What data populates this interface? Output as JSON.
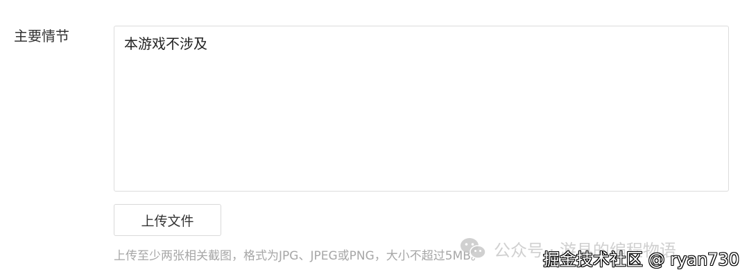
{
  "form": {
    "plot_label": "主要情节",
    "plot_value": "本游戏不涉及",
    "upload_button_label": "上传文件",
    "upload_hint": "上传至少两张相关截图，格式为JPG、JPEG或PNG，大小不超过5MB。"
  },
  "watermarks": {
    "wechat_account": "公众号 · 游县的编程物语",
    "juejin_credit": "掘金技术社区 @ ryan730"
  },
  "icons": {
    "wechat": "wechat-icon"
  },
  "colors": {
    "border": "#dcdcdc",
    "label_text": "#333333",
    "hint_text": "#a6a6a6"
  }
}
